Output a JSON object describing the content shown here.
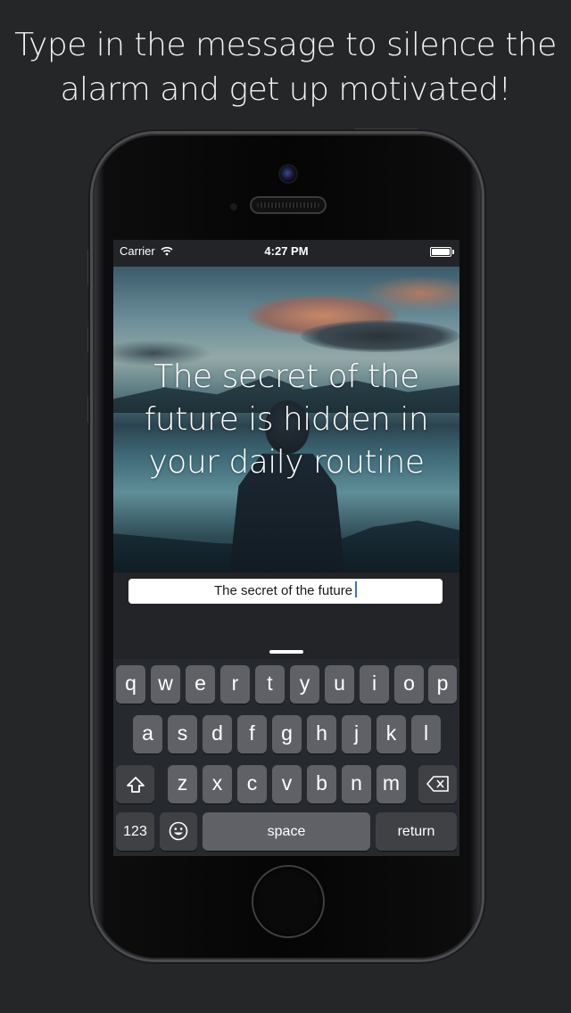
{
  "headline": [
    "Type in the message to silence the",
    "alarm and get up motivated!"
  ],
  "status_bar": {
    "carrier": "Carrier",
    "time": "4:27 PM",
    "wifi_icon": "wifi-icon",
    "battery_icon": "battery-icon"
  },
  "quote": [
    "The secret of the",
    "future is hidden in",
    "your daily routine"
  ],
  "input": {
    "value": "The secret of the future"
  },
  "keyboard": {
    "row1": [
      "q",
      "w",
      "e",
      "r",
      "t",
      "y",
      "u",
      "i",
      "o",
      "p"
    ],
    "row2": [
      "a",
      "s",
      "d",
      "f",
      "g",
      "h",
      "j",
      "k",
      "l"
    ],
    "row3": [
      "z",
      "x",
      "c",
      "v",
      "b",
      "n",
      "m"
    ],
    "shift_icon": "shift-icon",
    "delete_icon": "delete-icon",
    "numbers": "123",
    "emoji_icon": "emoji-icon",
    "space": "space",
    "return": "return"
  },
  "colors": {
    "background": "#252628",
    "keyboard": "#26292d",
    "key": "#5f6166",
    "caret": "#3a6fd8"
  }
}
